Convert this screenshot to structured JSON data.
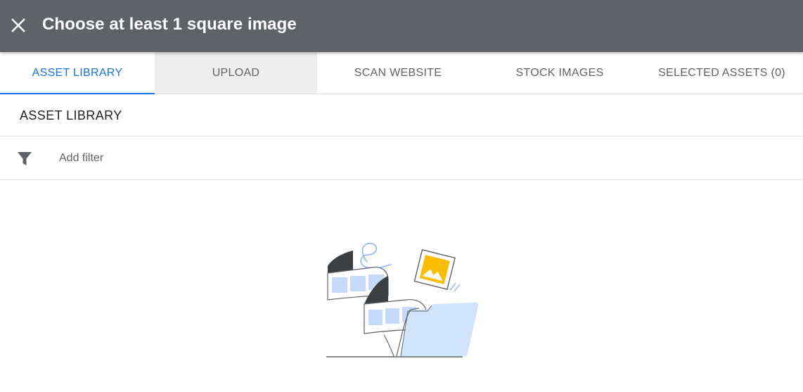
{
  "header": {
    "title": "Choose at least 1 square image",
    "close_icon": "close-icon"
  },
  "tabs": [
    {
      "label": "ASSET LIBRARY",
      "active": true
    },
    {
      "label": "UPLOAD",
      "active": false
    },
    {
      "label": "SCAN WEBSITE",
      "active": false
    },
    {
      "label": "STOCK IMAGES",
      "active": false
    },
    {
      "label": "SELECTED ASSETS (0)",
      "active": false
    }
  ],
  "section": {
    "title": "ASSET LIBRARY"
  },
  "filter": {
    "icon": "filter-icon",
    "placeholder": "Add filter",
    "value": ""
  },
  "empty_state": {
    "illustration": "empty-library-illustration"
  },
  "colors": {
    "header_bg": "#5f6368",
    "accent": "#1a73e8",
    "upload_tab_bg": "#eeeeee",
    "folder_blue": "#d2e3fc",
    "image_yellow": "#fbbc04"
  }
}
